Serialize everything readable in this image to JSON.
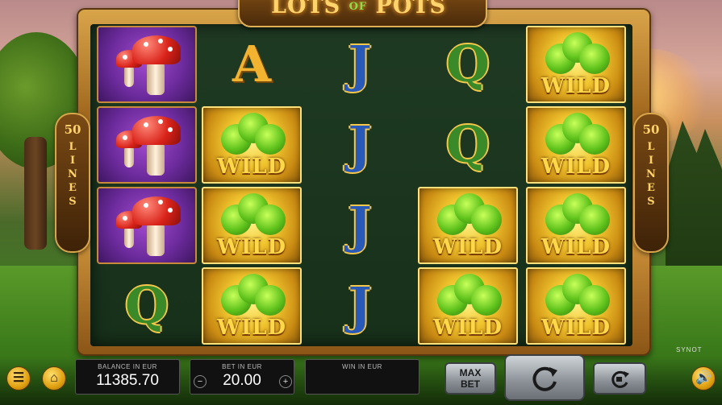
{
  "game": {
    "title_main": "LOTS",
    "title_of": "OF",
    "title_end": "POTS",
    "trademark": "™",
    "provider": "SYNOT"
  },
  "lines": {
    "count": "50",
    "word": [
      "L",
      "I",
      "N",
      "E",
      "S"
    ]
  },
  "reels": [
    [
      "mushroom",
      "mushroom",
      "mushroom",
      "Q"
    ],
    [
      "A",
      "WILD",
      "WILD",
      "WILD"
    ],
    [
      "J",
      "J",
      "J",
      "J"
    ],
    [
      "Q",
      "Q",
      "WILD",
      "WILD"
    ],
    [
      "WILD",
      "WILD",
      "WILD",
      "WILD"
    ]
  ],
  "wild_label": "WILD",
  "panels": {
    "balance_label": "BALANCE IN EUR",
    "balance_value": "11385.70",
    "bet_label": "BET IN EUR",
    "bet_value": "20.00",
    "win_label": "WIN IN EUR",
    "win_value": ""
  },
  "buttons": {
    "menu_icon": "hamburger-menu-icon",
    "home_icon": "home-icon",
    "max_bet_line1": "MAX",
    "max_bet_line2": "BET",
    "spin_icon": "spin-arrow-icon",
    "autoplay_icon": "autoplay-icon",
    "sound_icon": "speaker-icon",
    "bet_minus": "−",
    "bet_plus": "+"
  }
}
